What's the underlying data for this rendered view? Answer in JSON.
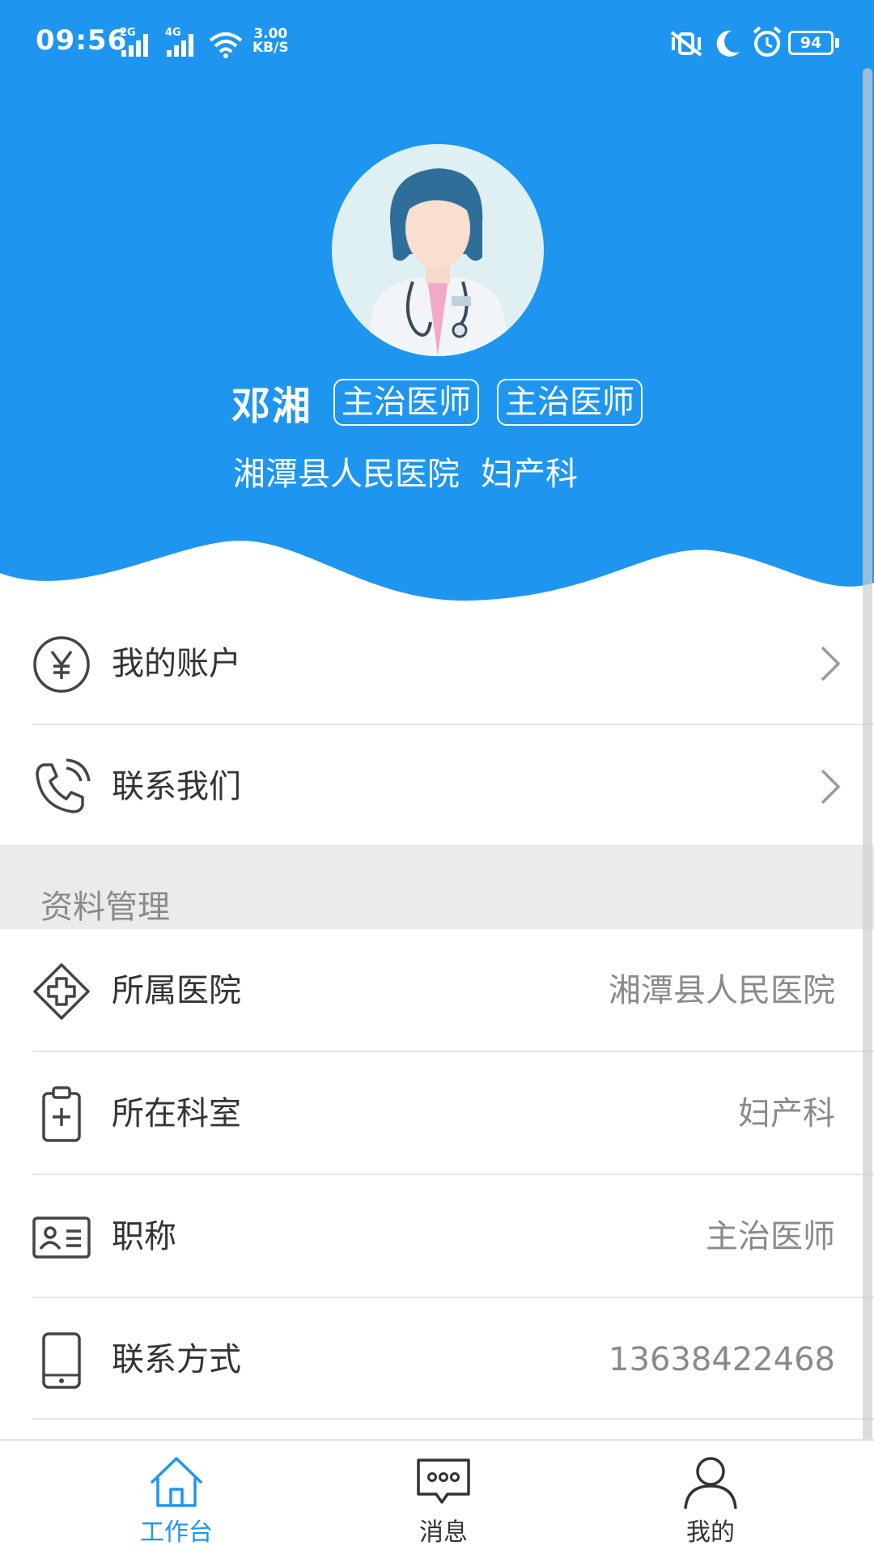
{
  "status_bar": {
    "time": "09:56",
    "signal1_label": "2G",
    "signal2_label": "4G",
    "speed_value": "3.00",
    "speed_unit": "KB/S",
    "battery": "94",
    "icons": [
      "wifi-icon",
      "mute-vibrate-icon",
      "moon-icon",
      "alarm-icon",
      "battery-icon"
    ]
  },
  "profile": {
    "name": "邓湘",
    "tags": [
      "主治医师",
      "主治医师"
    ],
    "hospital": "湘潭县人民医院",
    "department": "妇产科"
  },
  "menu": [
    {
      "label": "我的账户",
      "icon": "yuan-coin-icon"
    },
    {
      "label": "联系我们",
      "icon": "phone-call-icon"
    }
  ],
  "section": {
    "title": "资料管理"
  },
  "info": [
    {
      "label": "所属医院",
      "value": "湘潭县人民医院",
      "icon": "hospital-cross-icon"
    },
    {
      "label": "所在科室",
      "value": "妇产科",
      "icon": "clipboard-plus-icon"
    },
    {
      "label": "职称",
      "value": "主治医师",
      "icon": "id-card-icon"
    },
    {
      "label": "联系方式",
      "value": "13638422468",
      "icon": "mobile-phone-icon"
    }
  ],
  "nav": [
    {
      "label": "工作台",
      "icon": "home-icon",
      "active": true
    },
    {
      "label": "消息",
      "icon": "message-icon",
      "active": false
    },
    {
      "label": "我的",
      "icon": "person-icon",
      "active": false
    }
  ],
  "colors": {
    "primary": "#1e96f0",
    "text": "#333333",
    "muted": "#8a8a8a",
    "section_bg": "#ebebed"
  }
}
